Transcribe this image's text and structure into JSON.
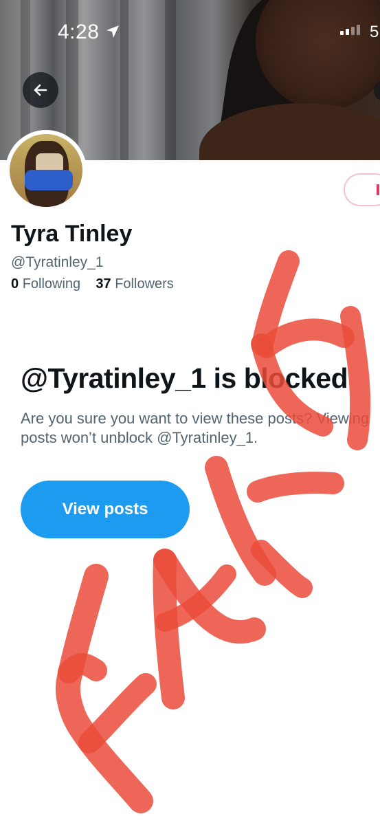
{
  "status_bar": {
    "time": "4:28",
    "extra": "5"
  },
  "icons": {
    "back": "arrow-left-icon",
    "location": "location-arrow-icon",
    "signal": "cellular-signal-icon"
  },
  "profile": {
    "name": "Tyra Tinley",
    "handle": "@Tyratinley_1",
    "following_count": "0",
    "following_label": "Following",
    "followers_count": "37",
    "followers_label": "Followers"
  },
  "blocked": {
    "title": "@Tyratinley_1 is blocked",
    "description": "Are you sure you want to view these posts? Viewing posts won’t unblock @Tyratinley_1.",
    "button_label": "View posts"
  },
  "colors": {
    "accent": "#1d9bf0",
    "overlay_ink": "#ea4b3a"
  }
}
